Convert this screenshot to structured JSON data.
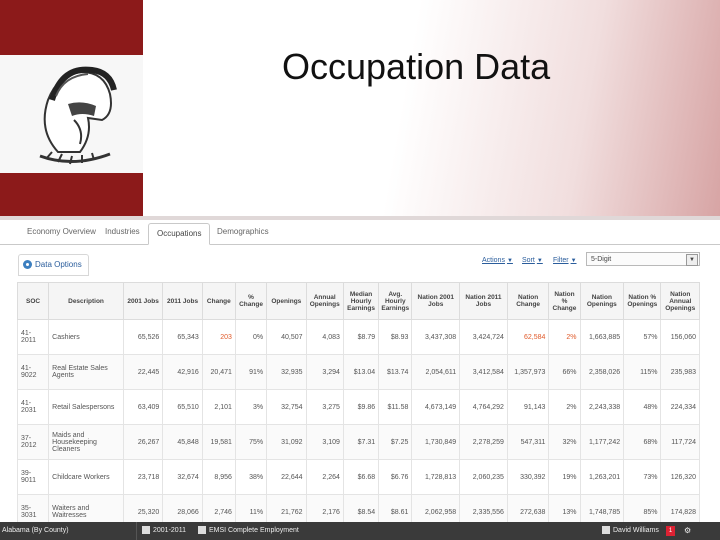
{
  "slide": {
    "title": "Occupation Data"
  },
  "tabs": [
    {
      "label": "Economy Overview"
    },
    {
      "label": "Industries"
    },
    {
      "label": "Occupations"
    },
    {
      "label": "Demographics"
    }
  ],
  "toolbar": {
    "data_options": "Data Options",
    "actions": "Actions",
    "sort": "Sort",
    "filter": "Filter",
    "digit_select": "5-Digit"
  },
  "table": {
    "headers": [
      "SOC",
      "Description",
      "2001 Jobs",
      "2011 Jobs",
      "Change",
      "% Change",
      "Openings",
      "Annual Openings",
      "Median Hourly Earnings",
      "Avg. Hourly Earnings",
      "Nation 2001 Jobs",
      "Nation 2011 Jobs",
      "Nation Change",
      "Nation % Change",
      "Nation Openings",
      "Nation % Openings",
      "Nation Annual Openings"
    ],
    "rows": [
      [
        "41-2011",
        "Cashiers",
        "65,526",
        "65,343",
        "203",
        "0%",
        "40,507",
        "4,083",
        "$8.79",
        "$8.93",
        "3,437,308",
        "3,424,724",
        "62,584",
        "2%",
        "1,663,885",
        "57%",
        "156,060"
      ],
      [
        "41-9022",
        "Real Estate Sales Agents",
        "22,445",
        "42,916",
        "20,471",
        "91%",
        "32,935",
        "3,294",
        "$13.04",
        "$13.74",
        "2,054,611",
        "3,412,584",
        "1,357,973",
        "66%",
        "2,358,026",
        "115%",
        "235,983"
      ],
      [
        "41-2031",
        "Retail Salespersons",
        "63,409",
        "65,510",
        "2,101",
        "3%",
        "32,754",
        "3,275",
        "$9.86",
        "$11.58",
        "4,673,149",
        "4,764,292",
        "91,143",
        "2%",
        "2,243,338",
        "48%",
        "224,334"
      ],
      [
        "37-2012",
        "Maids and Housekeeping Cleaners",
        "26,267",
        "45,848",
        "19,581",
        "75%",
        "31,092",
        "3,109",
        "$7.31",
        "$7.25",
        "1,730,849",
        "2,278,259",
        "547,311",
        "32%",
        "1,177,242",
        "68%",
        "117,724"
      ],
      [
        "39-9011",
        "Childcare Workers",
        "23,718",
        "32,674",
        "8,956",
        "38%",
        "22,644",
        "2,264",
        "$6.68",
        "$6.76",
        "1,728,813",
        "2,060,235",
        "330,392",
        "19%",
        "1,263,201",
        "73%",
        "126,320"
      ],
      [
        "35-3031",
        "Waiters and Waitresses",
        "25,320",
        "28,066",
        "2,746",
        "11%",
        "21,762",
        "2,176",
        "$8.54",
        "$8.61",
        "2,062,958",
        "2,335,556",
        "272,638",
        "13%",
        "1,748,785",
        "85%",
        "174,828"
      ]
    ]
  },
  "statusbar": {
    "region": "Alabama (By County)",
    "years": "2001-2011",
    "dataset": "EMSI Complete Employment",
    "user": "David Williams",
    "badge": "1"
  }
}
